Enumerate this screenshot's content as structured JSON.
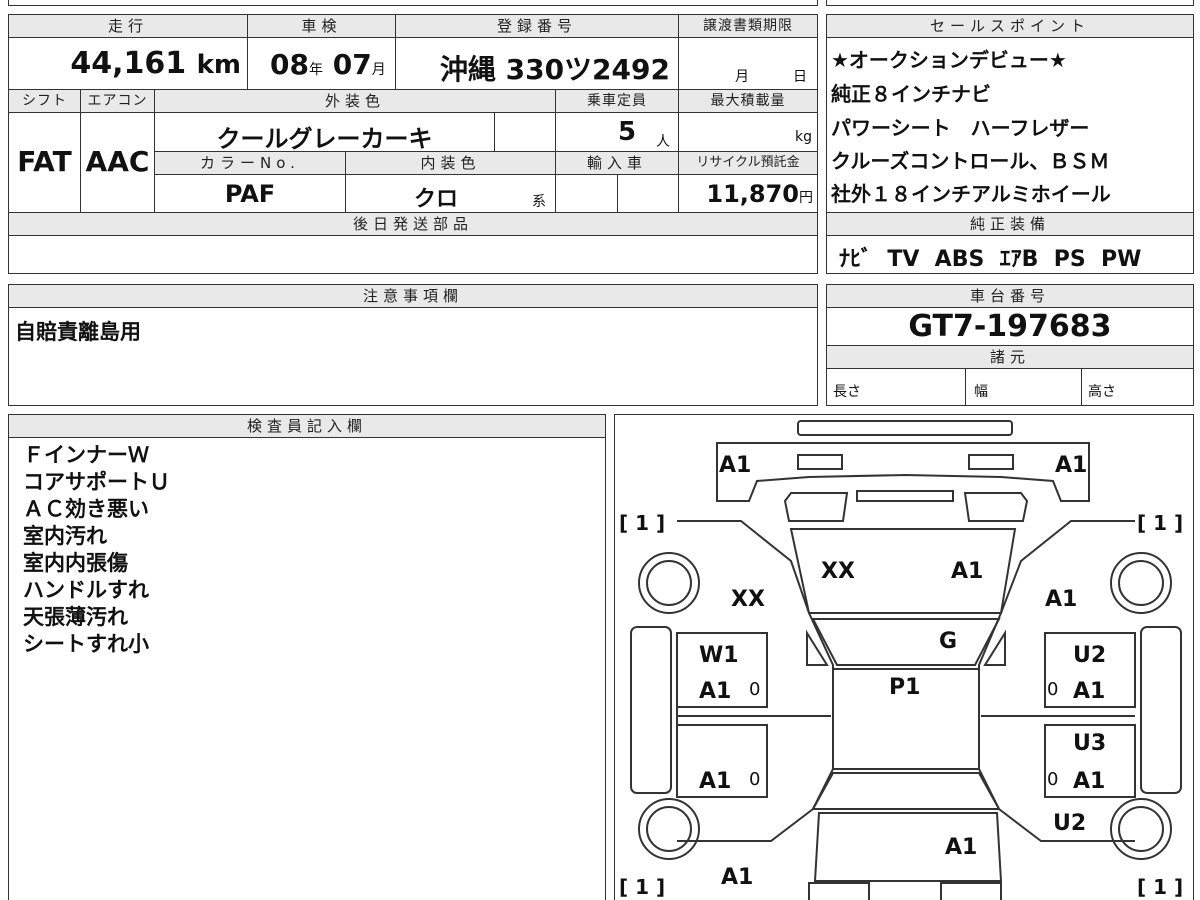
{
  "form": {
    "headers": {
      "mileage": "走行",
      "inspection": "車検",
      "registration": "登録番号",
      "transfer_deadline": "譲渡書類期限",
      "sales_point": "セールスポイント",
      "shift": "シフト",
      "aircon": "エアコン",
      "exterior_color": "外装色",
      "capacity": "乗車定員",
      "max_load": "最大積載量",
      "color_no": "カラーNo.",
      "interior_color": "内装色",
      "import": "輸入車",
      "recycle": "リサイクル預託金",
      "later_parts": "後日発送部品",
      "genuine_equipment": "純正装備",
      "notes": "注意事項欄",
      "chassis_no": "車台番号",
      "specs": "諸元",
      "inspector": "検査員記入欄"
    },
    "mileage": {
      "value": "44,161",
      "unit": "km"
    },
    "inspection": {
      "year": "08",
      "year_unit": "年",
      "month": "07",
      "month_unit": "月"
    },
    "registration": {
      "region": "沖縄",
      "number": "330ツ2492"
    },
    "transfer_deadline": {
      "month_unit": "月",
      "day_unit": "日"
    },
    "shift": "FAT",
    "aircon": "AAC",
    "exterior_color": "クールグレーカーキ",
    "capacity": {
      "value": "5",
      "unit": "人"
    },
    "max_load": {
      "value": "",
      "unit": "kg"
    },
    "color_no": "PAF",
    "interior_color": {
      "value": "クロ",
      "suffix": "系"
    },
    "recycle": {
      "value": "11,870",
      "unit": "円"
    },
    "sales_points": [
      "★オークションデビュー★",
      "純正８インチナビ",
      "パワーシート　ハーフレザー",
      "クルーズコントロール、ＢＳＭ",
      "社外１８インチアルミホイール"
    ],
    "genuine_equipment": "ﾅﾋﾞ  TV  ABS  ｴｱB  PS  PW",
    "notes": "自賠責離島用",
    "chassis_no": "GT7-197683",
    "specs": {
      "length": "長さ",
      "width": "幅",
      "height": "高さ"
    },
    "inspector_notes": [
      "ＦインナーＷ",
      "コアサポートＵ",
      "ＡＣ効き悪い",
      "室内汚れ",
      "室内内張傷",
      "ハンドルすれ",
      "天張薄汚れ",
      "シートすれ小"
    ]
  },
  "diagram": {
    "marks": {
      "front_left": "A1",
      "front_right": "A1",
      "tire_fl": "[ 1 ]",
      "tire_fr": "[ 1 ]",
      "tire_rl": "[ 1 ]",
      "tire_rr": "[ 1 ]",
      "fender_left": "XX",
      "hood_left": "XX",
      "hood_right": "A1",
      "fender_right": "A1",
      "windshield": "G",
      "roof": "P1",
      "front_door_left_1": "W1",
      "front_door_left_2": "A1",
      "rear_door_left": "A1",
      "front_door_right_1": "U2",
      "front_door_right_2": "A1",
      "rear_door_right_1": "U3",
      "rear_door_right_2": "A1",
      "quarter_right": "U2",
      "trunk": "A1",
      "rear_left": "A1",
      "zero_marks": "0"
    }
  }
}
